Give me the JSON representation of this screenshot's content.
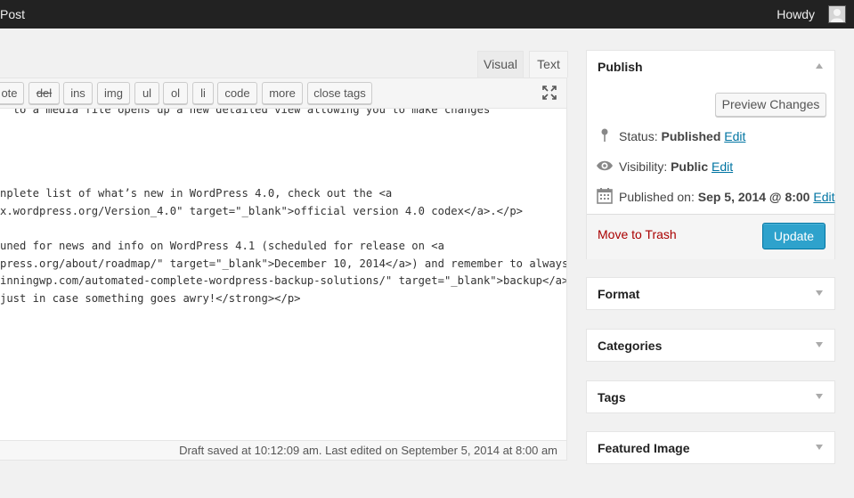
{
  "adminbar": {
    "left_label": "Post",
    "howdy": "Howdy"
  },
  "editor": {
    "tabs": [
      {
        "label": "Visual"
      },
      {
        "label": "Text"
      }
    ],
    "quicktags": [
      {
        "label": "ote"
      },
      {
        "label": "del"
      },
      {
        "label": "ins"
      },
      {
        "label": "img"
      },
      {
        "label": "ul"
      },
      {
        "label": "ol"
      },
      {
        "label": "li"
      },
      {
        "label": "code"
      },
      {
        "label": "more"
      },
      {
        "label": "close tags"
      }
    ],
    "lines": [
      "  to a media file opens up a new detailed view allowing you to make changes",
      "",
      "",
      "",
      "nplete list of what’s new in WordPress 4.0, check out the <a",
      "x.wordpress.org/Version_4.0\" target=\"_blank\">official version 4.0 codex</a>.</p>",
      "",
      "uned for news and info on WordPress 4.1 (scheduled for release on <a",
      "press.org/about/roadmap/\" target=\"_blank\">December 10, 2014</a>) and remember to always",
      "inningwp.com/automated-complete-wordpress-backup-solutions/\" target=\"_blank\">backup</a>",
      "just in case something goes awry!</strong></p>"
    ],
    "status": "Draft saved at 10:12:09 am. Last edited on September 5, 2014 at 8:00 am"
  },
  "publish": {
    "title": "Publish",
    "preview_label": "Preview Changes",
    "status_label": "Status:",
    "status_value": "Published",
    "visibility_label": "Visibility:",
    "visibility_value": "Public",
    "published_label": "Published on:",
    "published_value": "Sep 5, 2014 @ 8:00",
    "edit_label": "Edit",
    "trash_label": "Move to Trash",
    "update_label": "Update"
  },
  "boxes": {
    "format": "Format",
    "categories": "Categories",
    "tags": "Tags",
    "featured": "Featured Image"
  },
  "colors": {
    "accent": "#2ea2cc",
    "link": "#0074a2",
    "trash": "#aa0000",
    "adminbar": "#222222"
  }
}
